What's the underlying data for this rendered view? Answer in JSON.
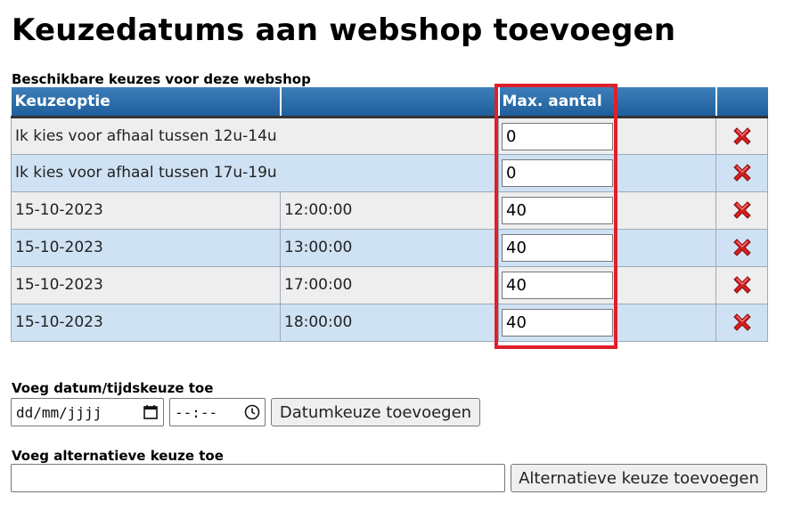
{
  "page": {
    "title": "Keuzedatums aan webshop toevoegen",
    "table_caption": "Beschikbare keuzes voor deze webshop"
  },
  "table": {
    "headers": {
      "option": "Keuzeoptie",
      "max": "Max. aantal"
    },
    "rows": [
      {
        "option": "Ik kies voor afhaal tussen 12u-14u",
        "time": "",
        "max": "0"
      },
      {
        "option": "Ik kies voor afhaal tussen 17u-19u",
        "time": "",
        "max": "0"
      },
      {
        "option": "15-10-2023",
        "time": "12:00:00",
        "max": "40"
      },
      {
        "option": "15-10-2023",
        "time": "13:00:00",
        "max": "40"
      },
      {
        "option": "15-10-2023",
        "time": "17:00:00",
        "max": "40"
      },
      {
        "option": "15-10-2023",
        "time": "18:00:00",
        "max": "40"
      }
    ],
    "delete_icon": "red-x-icon"
  },
  "add_date": {
    "label": "Voeg datum/tijdskeuze toe",
    "date_placeholder": "dd/mm/jjjj",
    "time_placeholder": "--:--",
    "button": "Datumkeuze toevoegen"
  },
  "add_alt": {
    "label": "Voeg alternatieve keuze toe",
    "value": "",
    "button": "Alternatieve keuze toevoegen"
  },
  "colors": {
    "header_bg": "#2a6ca8",
    "row_odd": "#eeeeee",
    "row_even": "#cfe2f3",
    "highlight": "#e0202a",
    "delete_icon": "#d42020"
  }
}
